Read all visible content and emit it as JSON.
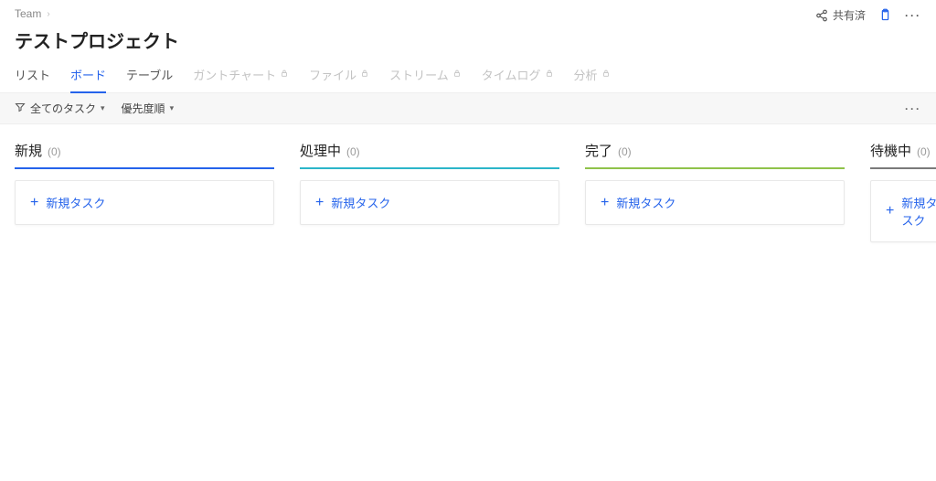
{
  "breadcrumb": {
    "root": "Team"
  },
  "header": {
    "share_label": "共有済"
  },
  "project": {
    "title": "テストプロジェクト"
  },
  "tabs": [
    {
      "label": "リスト",
      "locked": false,
      "active": false
    },
    {
      "label": "ボード",
      "locked": false,
      "active": true
    },
    {
      "label": "テーブル",
      "locked": false,
      "active": false
    },
    {
      "label": "ガントチャート",
      "locked": true,
      "active": false
    },
    {
      "label": "ファイル",
      "locked": true,
      "active": false
    },
    {
      "label": "ストリーム",
      "locked": true,
      "active": false
    },
    {
      "label": "タイムログ",
      "locked": true,
      "active": false
    },
    {
      "label": "分析",
      "locked": true,
      "active": false
    }
  ],
  "toolbar": {
    "filter_label": "全てのタスク",
    "sort_label": "優先度順"
  },
  "board": {
    "new_task_label": "新規タスク",
    "columns": [
      {
        "title": "新規",
        "count": "(0)",
        "color": "#2563eb"
      },
      {
        "title": "処理中",
        "count": "(0)",
        "color": "#2bb6c9"
      },
      {
        "title": "完了",
        "count": "(0)",
        "color": "#8fc24a"
      },
      {
        "title": "待機中",
        "count": "(0)",
        "color": "#7a7a7a"
      }
    ]
  }
}
